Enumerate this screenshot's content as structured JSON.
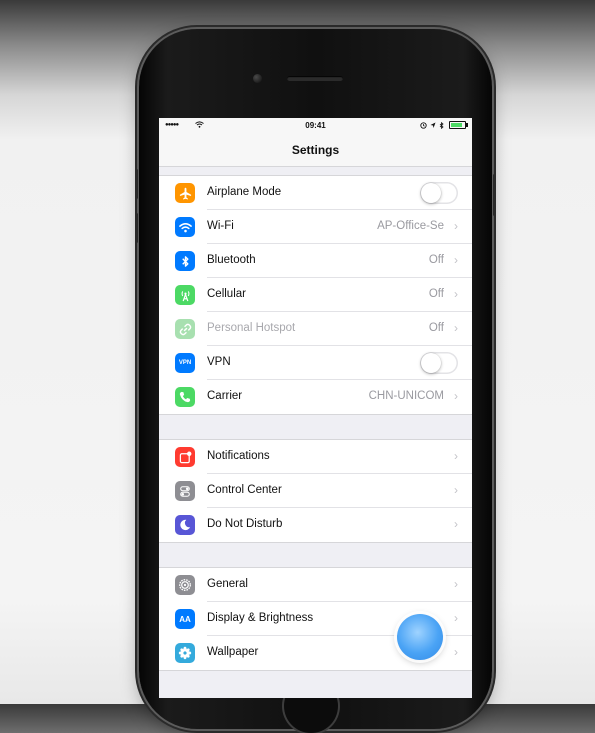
{
  "statusbar": {
    "signal": "●●●●●",
    "time": "09:41",
    "battery_level": 0.85
  },
  "navbar": {
    "title": "Settings"
  },
  "groups": [
    [
      {
        "label": "Airplane Mode",
        "icon": "airplane-icon",
        "icon_color": "#ff9500",
        "control": "toggle",
        "toggle_on": false
      },
      {
        "label": "Wi-Fi",
        "icon": "wifi-icon",
        "icon_color": "#007aff",
        "value": "AP-Office-Se",
        "control": "chevron"
      },
      {
        "label": "Bluetooth",
        "icon": "bluetooth-icon",
        "icon_color": "#007aff",
        "value": "Off",
        "control": "chevron"
      },
      {
        "label": "Cellular",
        "icon": "cellular-icon",
        "icon_color": "#4cd964",
        "value": "Off",
        "control": "chevron"
      },
      {
        "label": "Personal Hotspot",
        "icon": "personal-hotspot-icon",
        "icon_color": "#a8e0b0",
        "value": "Off",
        "control": "chevron",
        "disabled": true
      },
      {
        "label": "VPN",
        "icon": "vpn-icon",
        "icon_color": "#007aff",
        "icon_text": "VPN",
        "control": "toggle",
        "toggle_on": false
      },
      {
        "label": "Carrier",
        "icon": "phone-icon",
        "icon_color": "#4cd964",
        "value": "CHN-UNICOM",
        "control": "chevron"
      }
    ],
    [
      {
        "label": "Notifications",
        "icon": "notifications-icon",
        "icon_color": "#ff3b30",
        "control": "chevron"
      },
      {
        "label": "Control Center",
        "icon": "control-center-icon",
        "icon_color": "#8e8e93",
        "control": "chevron"
      },
      {
        "label": "Do Not Disturb",
        "icon": "moon-icon",
        "icon_color": "#5856d6",
        "control": "chevron"
      }
    ],
    [
      {
        "label": "General",
        "icon": "gear-icon",
        "icon_color": "#8e8e93",
        "control": "chevron"
      },
      {
        "label": "Display & Brightness",
        "icon": "display-brightness-icon",
        "icon_color": "#007aff",
        "icon_text": "AA",
        "control": "chevron"
      },
      {
        "label": "Wallpaper",
        "icon": "wallpaper-icon",
        "icon_color": "#34aadc",
        "control": "chevron"
      }
    ]
  ],
  "colors": {
    "screen_background": "#efeff4",
    "separator": "#e2e2e6",
    "value_text": "#9a9aa0",
    "assistive_touch": "#4aa3f5"
  }
}
